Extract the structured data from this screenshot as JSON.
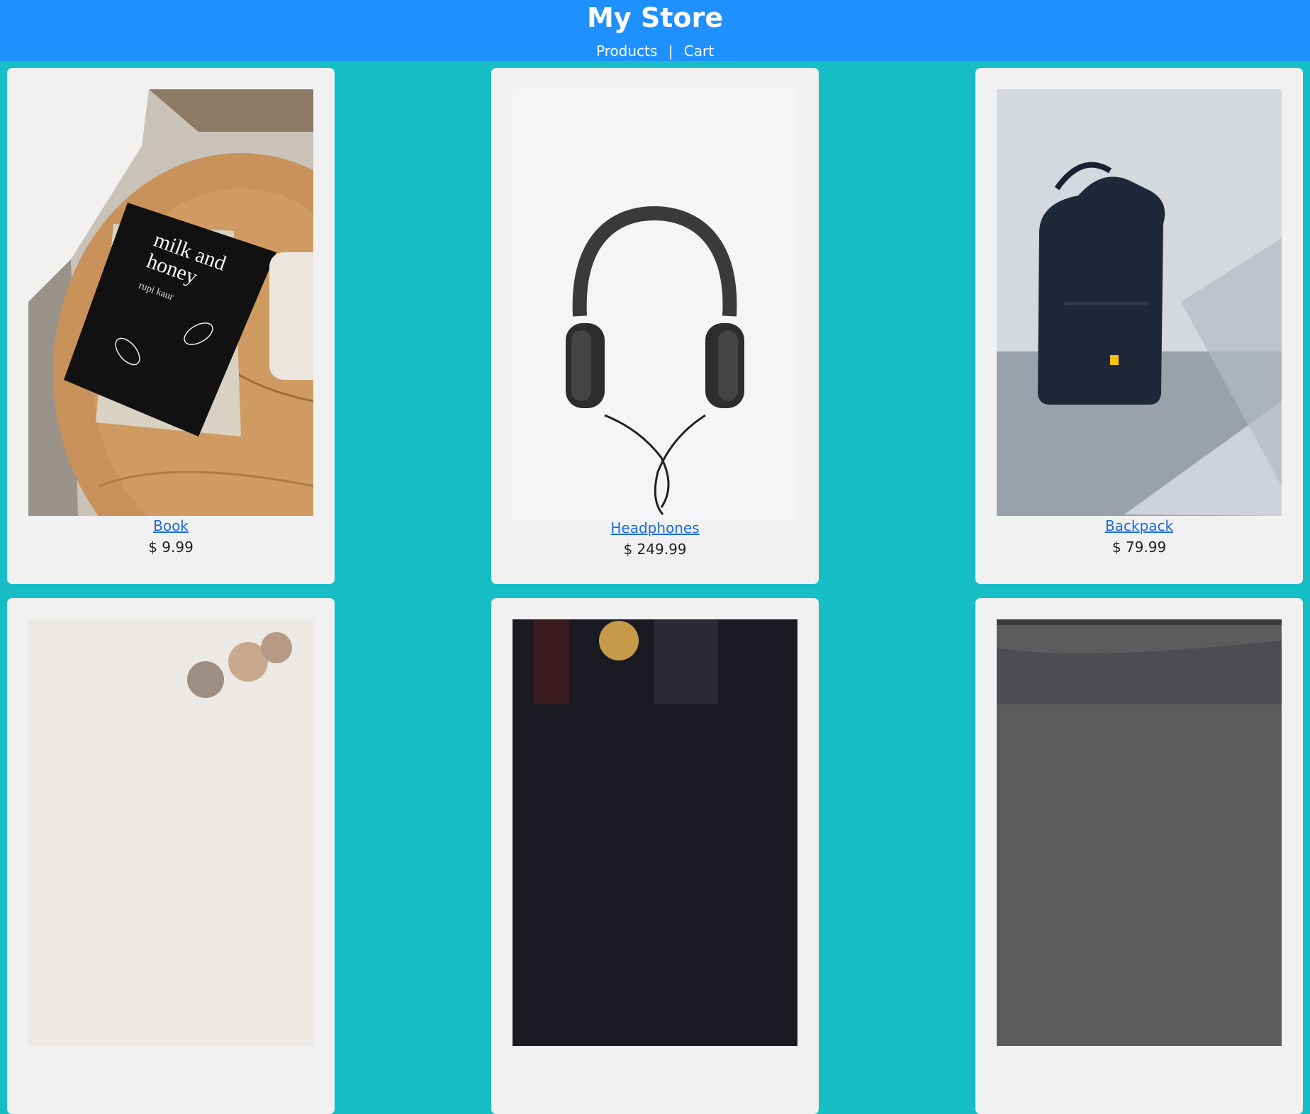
{
  "store": {
    "title": "My Store"
  },
  "nav": {
    "products": "Products",
    "separator": "|",
    "cart": "Cart"
  },
  "products": [
    {
      "name": "Book",
      "price": "$ 9.99"
    },
    {
      "name": "Headphones",
      "price": "$ 249.99"
    },
    {
      "name": "Backpack",
      "price": "$ 79.99"
    }
  ],
  "colors": {
    "header": "#1e90ff",
    "background": "#17bec6",
    "card": "#f1f1f1",
    "link": "#1c6cd8"
  }
}
